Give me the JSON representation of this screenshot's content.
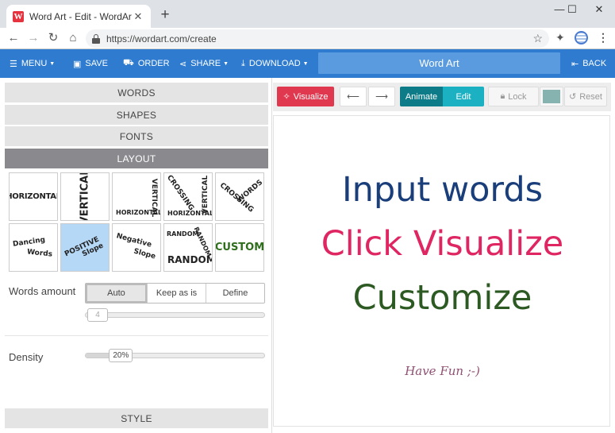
{
  "browser": {
    "tab_title": "Word Art - Edit - WordArt.com",
    "favicon_letter": "W",
    "url": "https://wordart.com/create",
    "controls": {
      "minimize": "—",
      "maximize": "☐",
      "close": "✕"
    }
  },
  "toolbar": {
    "menu": "MENU",
    "save": "SAVE",
    "order": "ORDER",
    "share": "SHARE",
    "download": "DOWNLOAD",
    "title": "Word Art",
    "back": "BACK"
  },
  "left_panel": {
    "sections": {
      "words": "WORDS",
      "shapes": "SHAPES",
      "fonts": "FONTS",
      "layout": "LAYOUT",
      "style": "STYLE"
    },
    "layouts": [
      {
        "name": "Horizontal",
        "selected": false
      },
      {
        "name": "Vertical",
        "selected": false
      },
      {
        "name": "Vertical Horizontal",
        "selected": false
      },
      {
        "name": "Crossing Vertical Horizontal",
        "selected": false
      },
      {
        "name": "Crossing Words",
        "selected": false
      },
      {
        "name": "Dancing Words",
        "selected": false
      },
      {
        "name": "Positive Slope",
        "selected": true
      },
      {
        "name": "Negative Slope",
        "selected": false
      },
      {
        "name": "Random Random Random",
        "selected": false
      },
      {
        "name": "Custom",
        "selected": false
      }
    ],
    "layout_words": {
      "horizontal": "Horizontal",
      "vertical": "Vertical",
      "crossing": "Crossing",
      "words": "Words",
      "dancing": "Dancing",
      "positive": "Positive",
      "slope": "Slope",
      "negative": "Negative",
      "random": "Random",
      "custom": "Custom"
    },
    "words_amount": {
      "label": "Words amount",
      "options": [
        "Auto",
        "Keep as is",
        "Define"
      ],
      "selected": "Auto",
      "slider_value": "4",
      "slider_fraction": 0.0
    },
    "density": {
      "label": "Density",
      "value": "20%",
      "fraction": 0.2
    }
  },
  "editor": {
    "visualize": "Visualize",
    "animate": "Animate",
    "edit": "Edit",
    "lock": "Lock",
    "reset": "Reset",
    "swatch_color": "#86b2b0"
  },
  "canvas": {
    "line1": "Input words",
    "line2": "Click Visualize",
    "line3": "Customize",
    "line4": "Have Fun ;-)",
    "colors": {
      "line1": "#1a3e7a",
      "line2": "#df2662",
      "line3": "#2d5a23",
      "line4": "#8f5072"
    }
  }
}
